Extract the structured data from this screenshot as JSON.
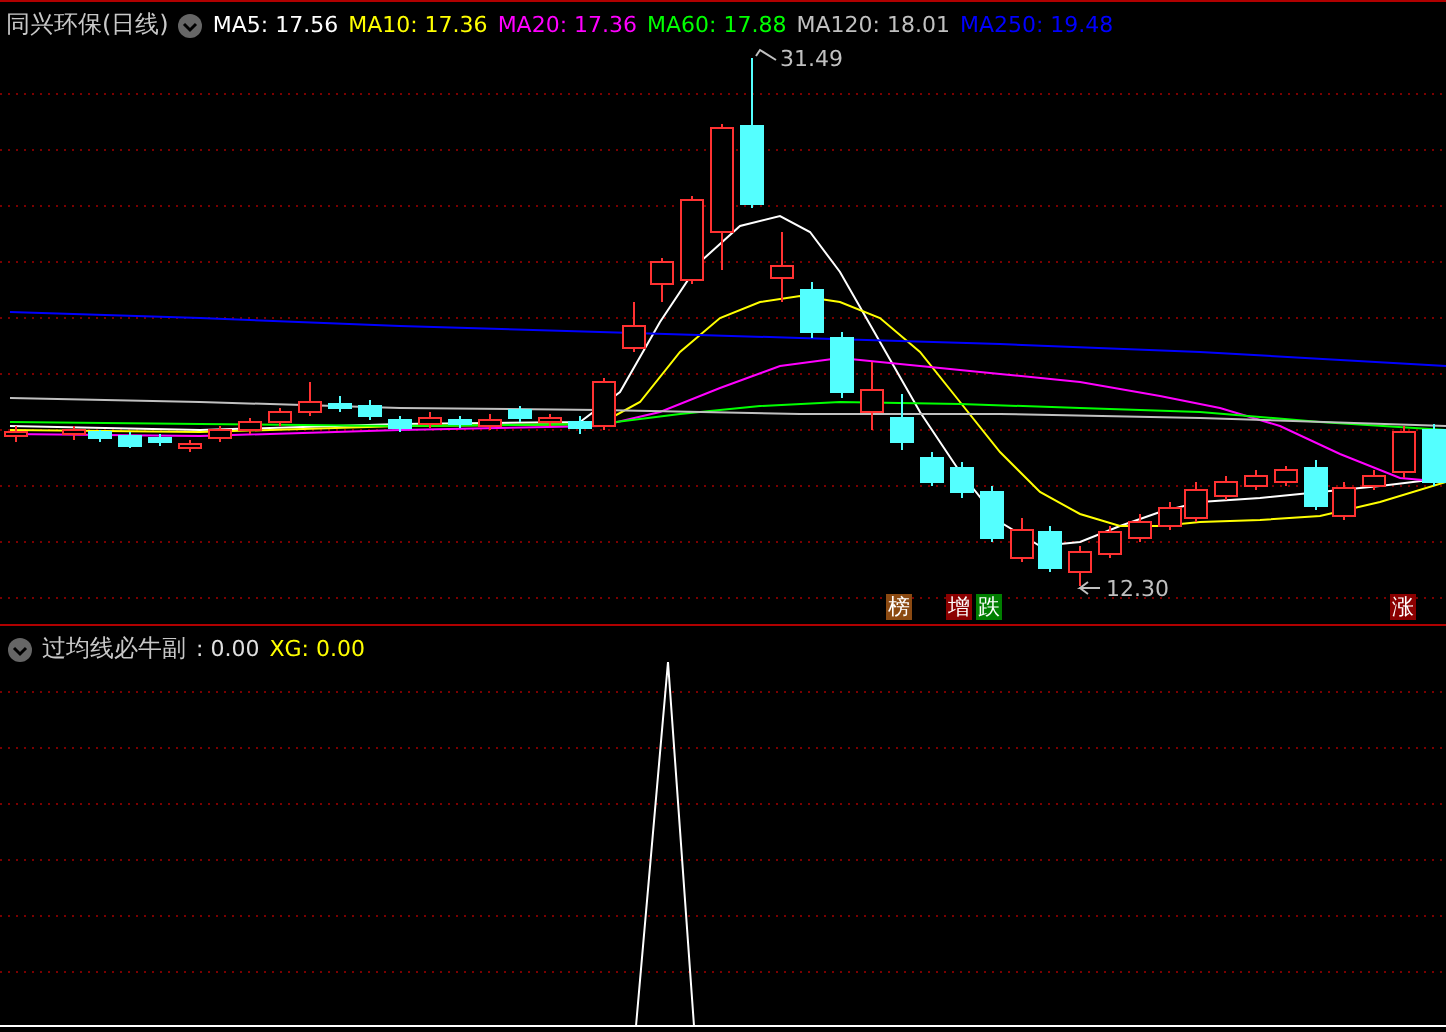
{
  "main_chart": {
    "title": "同兴环保(日线)",
    "indicators": [
      {
        "label": "MA5: 17.56",
        "color": "#ffffff"
      },
      {
        "label": "MA10: 17.36",
        "color": "#ffff00"
      },
      {
        "label": "MA20: 17.36",
        "color": "#ff00ff"
      },
      {
        "label": "MA60: 17.88",
        "color": "#00ff00"
      },
      {
        "label": "MA120: 18.01",
        "color": "#c0c0c0"
      },
      {
        "label": "MA250: 19.48",
        "color": "#0000ff"
      }
    ],
    "high_label": "31.49",
    "low_label": "12.30",
    "markers": [
      {
        "label": "榜",
        "color": "#8b4a12"
      },
      {
        "label": "增",
        "color": "#8b0000"
      },
      {
        "label": "跌",
        "color": "#007f00"
      },
      {
        "label": "涨",
        "color": "#8b0000"
      }
    ]
  },
  "sub_chart": {
    "title": "过均线必牛副",
    "value": ": 0.00",
    "xg_label": "XG: 0.00"
  }
}
